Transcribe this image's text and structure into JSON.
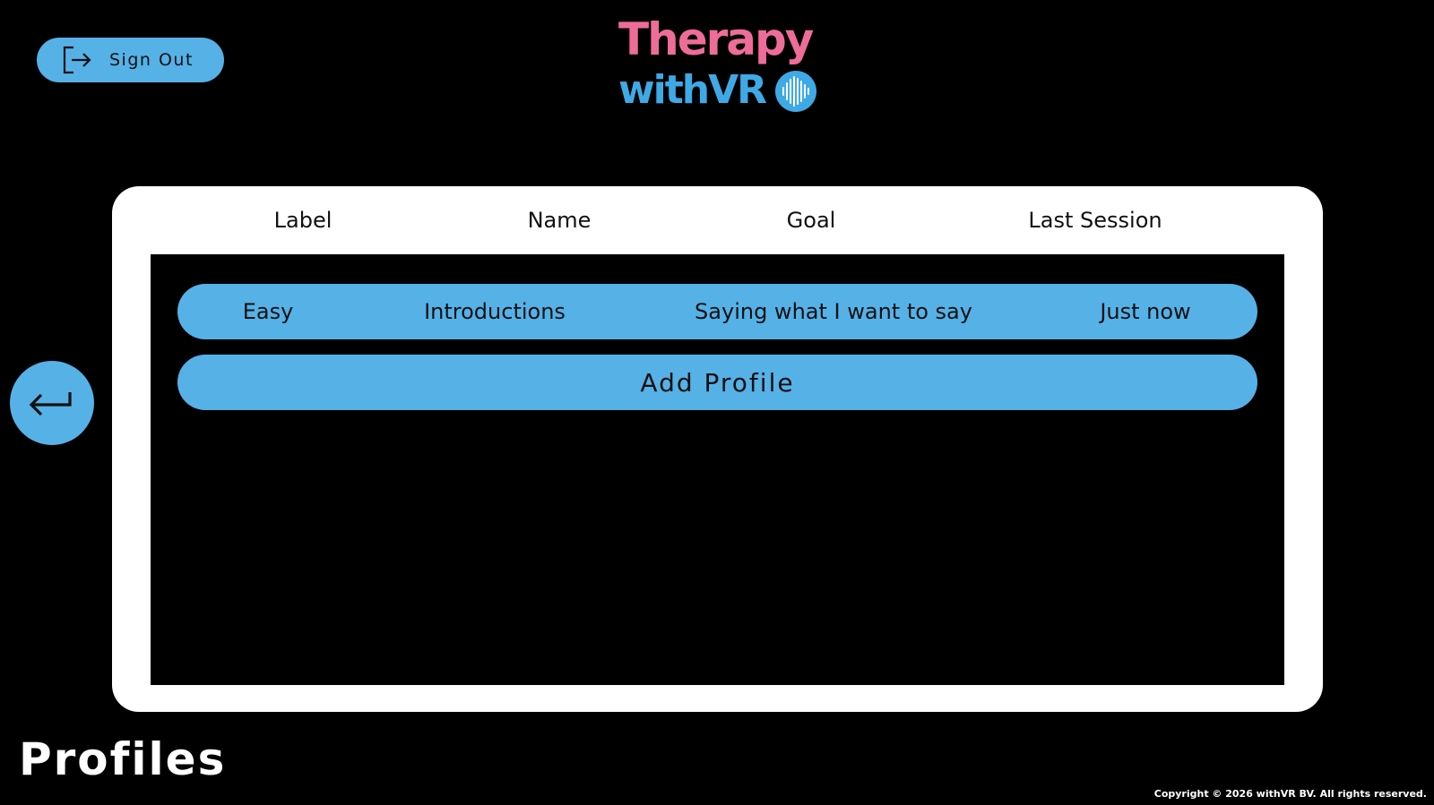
{
  "colors": {
    "accent": "#56b1e7",
    "logo_pink": "#ee6c9a",
    "logo_blue": "#3fa9e6",
    "background": "#000000",
    "panel": "#ffffff"
  },
  "header": {
    "sign_out_label": "Sign Out",
    "sign_out_icon": "logout-icon",
    "logo": {
      "line1": "Therapy",
      "line2": "withVR",
      "badge_icon": "soundwave-badge-icon"
    }
  },
  "nav": {
    "back_icon": "return-arrow-icon"
  },
  "table": {
    "columns": [
      "Label",
      "Name",
      "Goal",
      "Last Session"
    ],
    "rows": [
      {
        "label": "Easy",
        "name": "Introductions",
        "goal": "Saying what I want to say",
        "last_session": "Just now"
      }
    ],
    "add_label": "Add Profile"
  },
  "page": {
    "title": "Profiles",
    "copyright": "Copyright © 2026 withVR BV. All rights reserved."
  }
}
